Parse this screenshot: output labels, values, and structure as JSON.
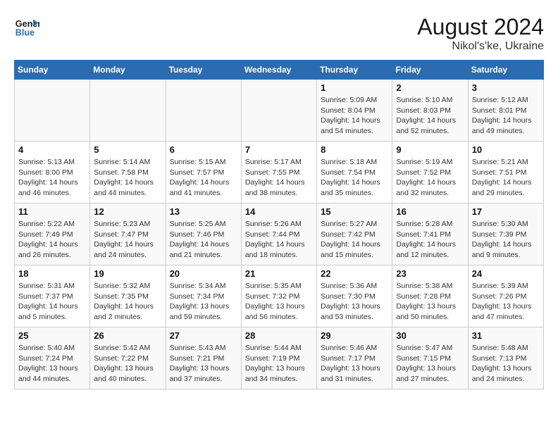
{
  "header": {
    "logo_line1": "General",
    "logo_line2": "Blue",
    "month_year": "August 2024",
    "location": "Nikol's'ke, Ukraine"
  },
  "weekdays": [
    "Sunday",
    "Monday",
    "Tuesday",
    "Wednesday",
    "Thursday",
    "Friday",
    "Saturday"
  ],
  "weeks": [
    [
      {
        "day": "",
        "info": ""
      },
      {
        "day": "",
        "info": ""
      },
      {
        "day": "",
        "info": ""
      },
      {
        "day": "",
        "info": ""
      },
      {
        "day": "1",
        "info": "Sunrise: 5:09 AM\nSunset: 8:04 PM\nDaylight: 14 hours\nand 54 minutes."
      },
      {
        "day": "2",
        "info": "Sunrise: 5:10 AM\nSunset: 8:03 PM\nDaylight: 14 hours\nand 52 minutes."
      },
      {
        "day": "3",
        "info": "Sunrise: 5:12 AM\nSunset: 8:01 PM\nDaylight: 14 hours\nand 49 minutes."
      }
    ],
    [
      {
        "day": "4",
        "info": "Sunrise: 5:13 AM\nSunset: 8:00 PM\nDaylight: 14 hours\nand 46 minutes."
      },
      {
        "day": "5",
        "info": "Sunrise: 5:14 AM\nSunset: 7:58 PM\nDaylight: 14 hours\nand 44 minutes."
      },
      {
        "day": "6",
        "info": "Sunrise: 5:15 AM\nSunset: 7:57 PM\nDaylight: 14 hours\nand 41 minutes."
      },
      {
        "day": "7",
        "info": "Sunrise: 5:17 AM\nSunset: 7:55 PM\nDaylight: 14 hours\nand 38 minutes."
      },
      {
        "day": "8",
        "info": "Sunrise: 5:18 AM\nSunset: 7:54 PM\nDaylight: 14 hours\nand 35 minutes."
      },
      {
        "day": "9",
        "info": "Sunrise: 5:19 AM\nSunset: 7:52 PM\nDaylight: 14 hours\nand 32 minutes."
      },
      {
        "day": "10",
        "info": "Sunrise: 5:21 AM\nSunset: 7:51 PM\nDaylight: 14 hours\nand 29 minutes."
      }
    ],
    [
      {
        "day": "11",
        "info": "Sunrise: 5:22 AM\nSunset: 7:49 PM\nDaylight: 14 hours\nand 26 minutes."
      },
      {
        "day": "12",
        "info": "Sunrise: 5:23 AM\nSunset: 7:47 PM\nDaylight: 14 hours\nand 24 minutes."
      },
      {
        "day": "13",
        "info": "Sunrise: 5:25 AM\nSunset: 7:46 PM\nDaylight: 14 hours\nand 21 minutes."
      },
      {
        "day": "14",
        "info": "Sunrise: 5:26 AM\nSunset: 7:44 PM\nDaylight: 14 hours\nand 18 minutes."
      },
      {
        "day": "15",
        "info": "Sunrise: 5:27 AM\nSunset: 7:42 PM\nDaylight: 14 hours\nand 15 minutes."
      },
      {
        "day": "16",
        "info": "Sunrise: 5:28 AM\nSunset: 7:41 PM\nDaylight: 14 hours\nand 12 minutes."
      },
      {
        "day": "17",
        "info": "Sunrise: 5:30 AM\nSunset: 7:39 PM\nDaylight: 14 hours\nand 9 minutes."
      }
    ],
    [
      {
        "day": "18",
        "info": "Sunrise: 5:31 AM\nSunset: 7:37 PM\nDaylight: 14 hours\nand 5 minutes."
      },
      {
        "day": "19",
        "info": "Sunrise: 5:32 AM\nSunset: 7:35 PM\nDaylight: 14 hours\nand 2 minutes."
      },
      {
        "day": "20",
        "info": "Sunrise: 5:34 AM\nSunset: 7:34 PM\nDaylight: 13 hours\nand 59 minutes."
      },
      {
        "day": "21",
        "info": "Sunrise: 5:35 AM\nSunset: 7:32 PM\nDaylight: 13 hours\nand 56 minutes."
      },
      {
        "day": "22",
        "info": "Sunrise: 5:36 AM\nSunset: 7:30 PM\nDaylight: 13 hours\nand 53 minutes."
      },
      {
        "day": "23",
        "info": "Sunrise: 5:38 AM\nSunset: 7:28 PM\nDaylight: 13 hours\nand 50 minutes."
      },
      {
        "day": "24",
        "info": "Sunrise: 5:39 AM\nSunset: 7:26 PM\nDaylight: 13 hours\nand 47 minutes."
      }
    ],
    [
      {
        "day": "25",
        "info": "Sunrise: 5:40 AM\nSunset: 7:24 PM\nDaylight: 13 hours\nand 44 minutes."
      },
      {
        "day": "26",
        "info": "Sunrise: 5:42 AM\nSunset: 7:22 PM\nDaylight: 13 hours\nand 40 minutes."
      },
      {
        "day": "27",
        "info": "Sunrise: 5:43 AM\nSunset: 7:21 PM\nDaylight: 13 hours\nand 37 minutes."
      },
      {
        "day": "28",
        "info": "Sunrise: 5:44 AM\nSunset: 7:19 PM\nDaylight: 13 hours\nand 34 minutes."
      },
      {
        "day": "29",
        "info": "Sunrise: 5:46 AM\nSunset: 7:17 PM\nDaylight: 13 hours\nand 31 minutes."
      },
      {
        "day": "30",
        "info": "Sunrise: 5:47 AM\nSunset: 7:15 PM\nDaylight: 13 hours\nand 27 minutes."
      },
      {
        "day": "31",
        "info": "Sunrise: 5:48 AM\nSunset: 7:13 PM\nDaylight: 13 hours\nand 24 minutes."
      }
    ]
  ]
}
